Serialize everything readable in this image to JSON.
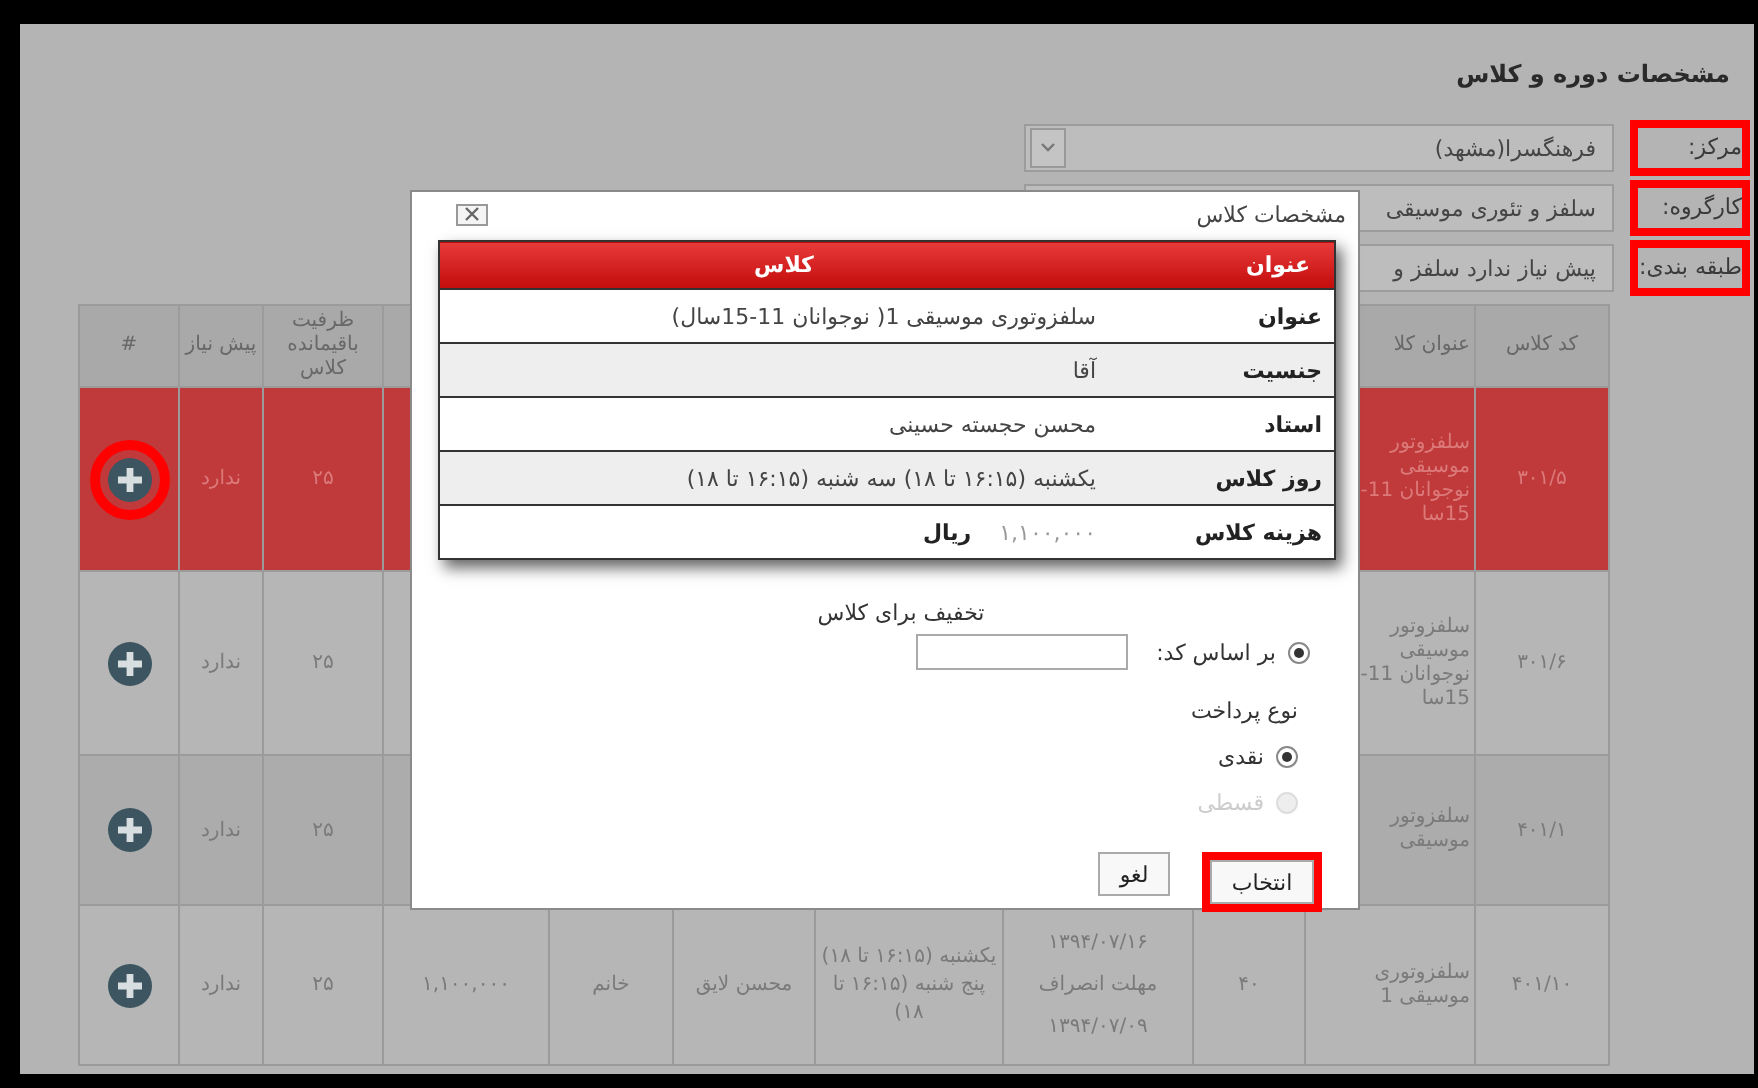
{
  "page_title": "مشخصات دوره و کلاس",
  "fields": [
    {
      "label": "مرکز:",
      "value": "فرهنگسرا(مشهد)",
      "kind": "select",
      "annotated": true
    },
    {
      "label": "کارگروه:",
      "value": "سلفز و تئوری موسیقی",
      "kind": "text",
      "annotated": true
    },
    {
      "label": "طبقه بندی:",
      "value": "پیش نیاز ندارد سلفز و",
      "kind": "text",
      "annotated": true
    }
  ],
  "table": {
    "columns": [
      {
        "label": "کد کلاس"
      },
      {
        "label": "عنوان کلا"
      },
      {},
      {},
      {},
      {},
      {},
      {},
      {
        "label": "ظرفیت باقیمانده کلاس"
      },
      {
        "label": "پیش نیاز"
      },
      {
        "label": "#"
      }
    ],
    "rows": [
      {
        "selected": true,
        "highlighted": true,
        "cells": [
          "۳۰۱/۵",
          "سلفزوتور موسیقی نوجوانان 11-15سا",
          null,
          null,
          null,
          null,
          null,
          null,
          "۲۵",
          "ندارد"
        ]
      },
      {
        "selected": false,
        "highlighted": false,
        "cells": [
          "۳۰۱/۶",
          "سلفزوتور موسیقی نوجوانان 11-15سا",
          null,
          null,
          null,
          null,
          null,
          null,
          "۲۵",
          "ندارد"
        ]
      },
      {
        "selected": false,
        "highlighted": false,
        "cells": [
          "۴۰۱/۱",
          "سلفزوتور موسیقی",
          null,
          null,
          null,
          null,
          null,
          null,
          "۲۵",
          "ندارد"
        ]
      },
      {
        "selected": false,
        "highlighted": false,
        "cells": [
          "۴۰۱/۱۰",
          "سلفزوتوری موسیقی 1",
          "۴۰",
          [
            "۱۳۹۴/۰۷/۱۶",
            "مهلت انصراف",
            "۱۳۹۴/۰۷/۰۹"
          ],
          "یکشنبه (۱۶:۱۵ تا ۱۸) پنج شنبه (۱۶:۱۵ تا ۱۸)",
          "محسن لایق",
          "خانم",
          "۱,۱۰۰,۰۰۰",
          "۲۵",
          "ندارد"
        ]
      }
    ]
  },
  "dialog": {
    "title": "مشخصات کلاس",
    "details": {
      "headers": [
        "عنوان",
        "کلاس"
      ],
      "rows": [
        {
          "label": "عنوان",
          "value": "سلفزوتوری موسیقی 1( نوجوانان 11-15سال)"
        },
        {
          "label": "جنسیت",
          "value": "آقا"
        },
        {
          "label": "استاد",
          "value": "محسن حجسته حسینی"
        },
        {
          "label": "روز کلاس",
          "value": "یکشنبه (۱۶:۱۵ تا ۱۸) سه شنبه (۱۶:۱۵ تا ۱۸)"
        },
        {
          "label": "هزینه کلاس",
          "value": "۱,۱۰۰,۰۰۰",
          "unit": "ریال"
        }
      ]
    },
    "discount": {
      "heading": "تخفیف برای کلاس",
      "option": {
        "label": "بر اساس کد:",
        "selected": true
      }
    },
    "payment": {
      "heading": "نوع پرداخت",
      "options": [
        {
          "label": "نقدی",
          "selected": true,
          "disabled": false
        },
        {
          "label": "قسطی",
          "selected": false,
          "disabled": true
        }
      ]
    },
    "buttons": [
      {
        "label": "انتخاب",
        "annotated": true
      },
      {
        "label": "لغو",
        "annotated": false
      }
    ]
  }
}
